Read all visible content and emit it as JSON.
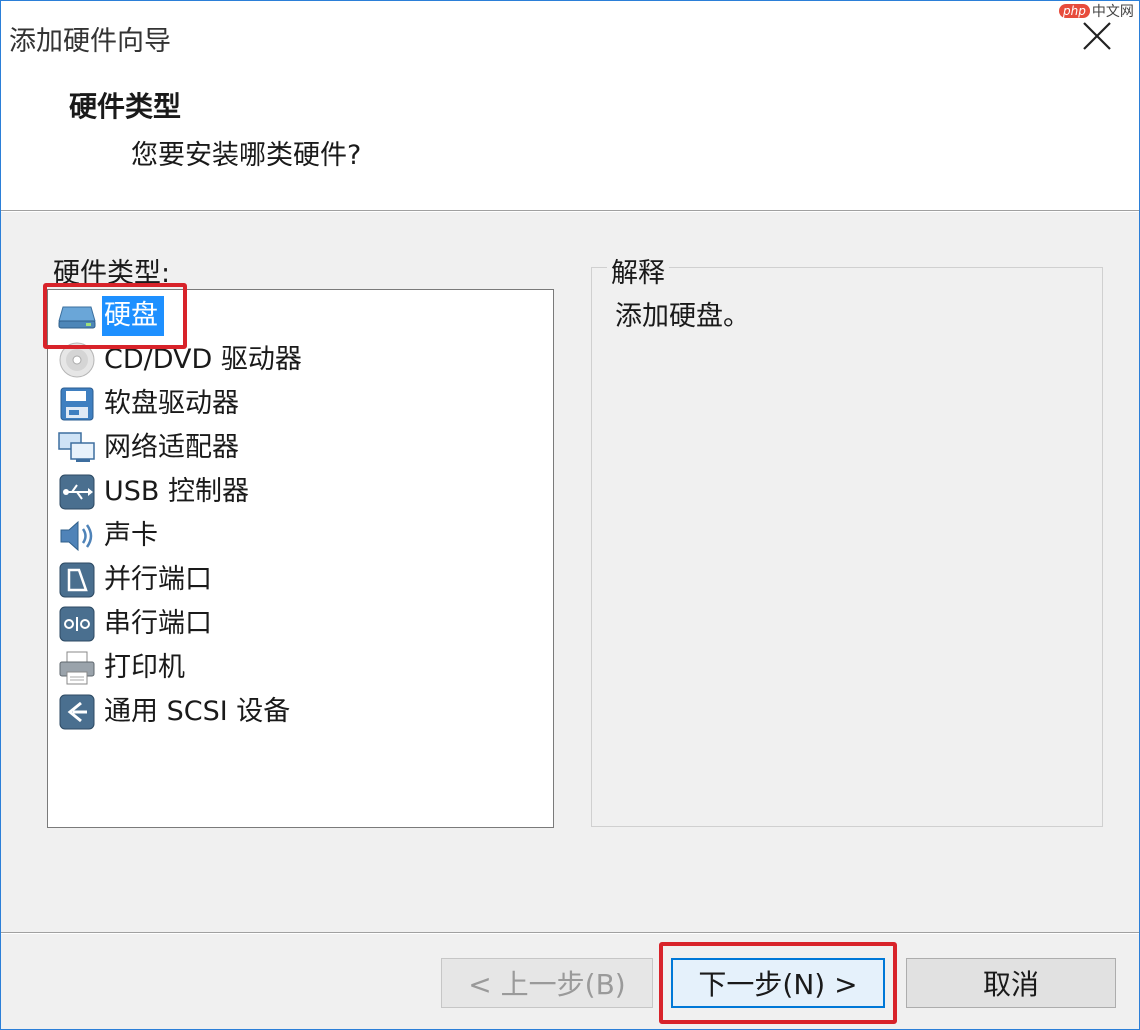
{
  "window": {
    "title": "添加硬件向导",
    "close_icon": "close-icon"
  },
  "watermark": {
    "badge": "php",
    "text": "中文网"
  },
  "header": {
    "title": "硬件类型",
    "subtitle": "您要安装哪类硬件?"
  },
  "hardware_list": {
    "label": "硬件类型:",
    "selected_index": 0,
    "items": [
      {
        "label": "硬盘",
        "icon": "hard-disk-icon"
      },
      {
        "label": "CD/DVD 驱动器",
        "icon": "cd-dvd-icon"
      },
      {
        "label": "软盘驱动器",
        "icon": "floppy-icon"
      },
      {
        "label": "网络适配器",
        "icon": "network-adapter-icon"
      },
      {
        "label": "USB 控制器",
        "icon": "usb-icon"
      },
      {
        "label": "声卡",
        "icon": "sound-card-icon"
      },
      {
        "label": "并行端口",
        "icon": "parallel-port-icon"
      },
      {
        "label": "串行端口",
        "icon": "serial-port-icon"
      },
      {
        "label": "打印机",
        "icon": "printer-icon"
      },
      {
        "label": "通用 SCSI 设备",
        "icon": "scsi-icon"
      }
    ]
  },
  "explanation": {
    "label": "解释",
    "text": "添加硬盘。"
  },
  "buttons": {
    "back": "< 上一步(B)",
    "next": "下一步(N) >",
    "cancel": "取消"
  },
  "colors": {
    "selection": "#1e90ff",
    "highlight_box": "#d8232a",
    "default_button_border": "#0078d7",
    "window_border": "#2b7fd8"
  }
}
